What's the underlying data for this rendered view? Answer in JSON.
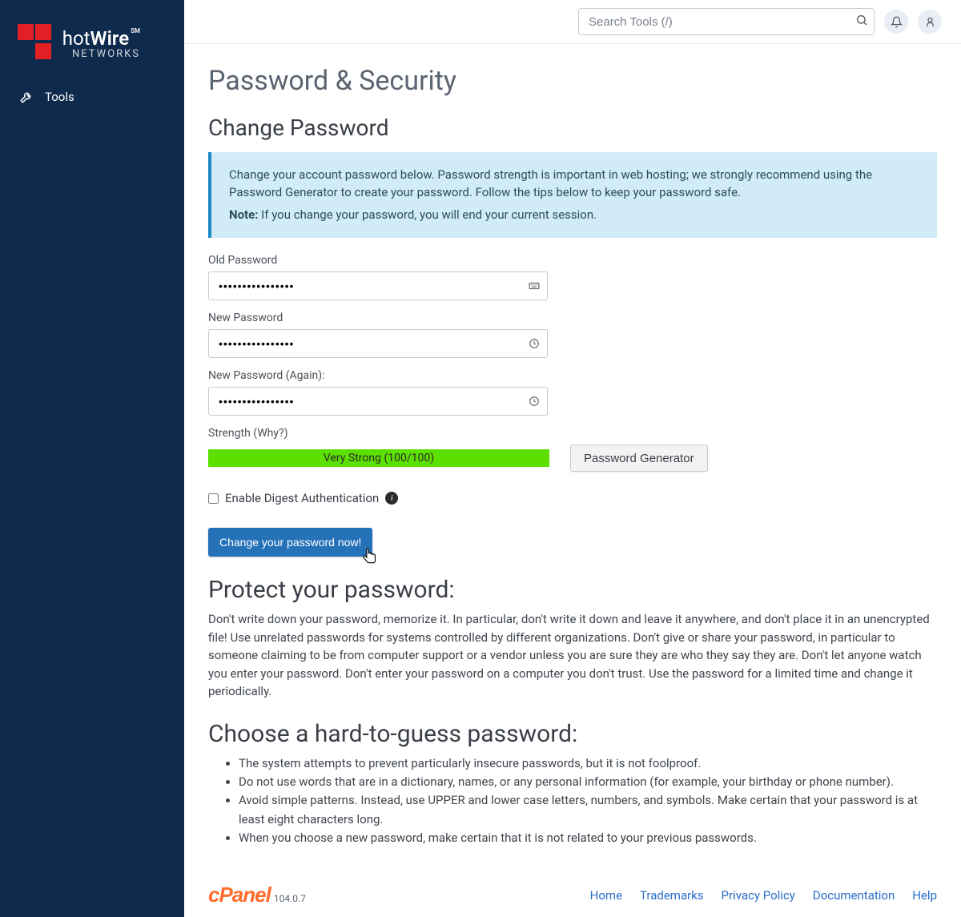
{
  "sidebar": {
    "brand_hot": "hot",
    "brand_wire": "Wire",
    "brand_sm": "SM",
    "brand_sub": "NETWORKS",
    "nav": {
      "tools": "Tools"
    }
  },
  "topbar": {
    "search_placeholder": "Search Tools (/)"
  },
  "page": {
    "title": "Password & Security",
    "change_heading": "Change Password",
    "info_p1": "Change your account password below. Password strength is important in web hosting; we strongly recommend using the Password Generator to create your password. Follow the tips below to keep your password safe.",
    "info_note_label": "Note:",
    "info_note_text": " If you change your password, you will end your current session.",
    "old_pw_label": "Old Password",
    "old_pw_value": "••••••••••••••••",
    "new_pw_label": "New Password",
    "new_pw_value": "••••••••••••••••",
    "new_pw2_label": "New Password (Again):",
    "new_pw2_value": "••••••••••••••••",
    "strength_label": "Strength (Why?)",
    "strength_text": "Very Strong (100/100)",
    "generator_btn": "Password Generator",
    "digest_label": "Enable Digest Authentication",
    "submit_btn": "Change your password now!",
    "protect_heading": "Protect your password:",
    "protect_text": "Don't write down your password, memorize it. In particular, don't write it down and leave it anywhere, and don't place it in an unencrypted file! Use unrelated passwords for systems controlled by different organizations. Don't give or share your password, in particular to someone claiming to be from computer support or a vendor unless you are sure they are who they say they are. Don't let anyone watch you enter your password. Don't enter your password on a computer you don't trust. Use the password for a limited time and change it periodically.",
    "choose_heading": "Choose a hard-to-guess password:",
    "tips": [
      "The system attempts to prevent particularly insecure passwords, but it is not foolproof.",
      "Do not use words that are in a dictionary, names, or any personal information (for example, your birthday or phone number).",
      "Avoid simple patterns. Instead, use UPPER and lower case letters, numbers, and symbols. Make certain that your password is at least eight characters long.",
      "When you choose a new password, make certain that it is not related to your previous passwords."
    ]
  },
  "footer": {
    "brand": "cPanel",
    "version": "104.0.7",
    "links": [
      "Home",
      "Trademarks",
      "Privacy Policy",
      "Documentation",
      "Help"
    ]
  }
}
